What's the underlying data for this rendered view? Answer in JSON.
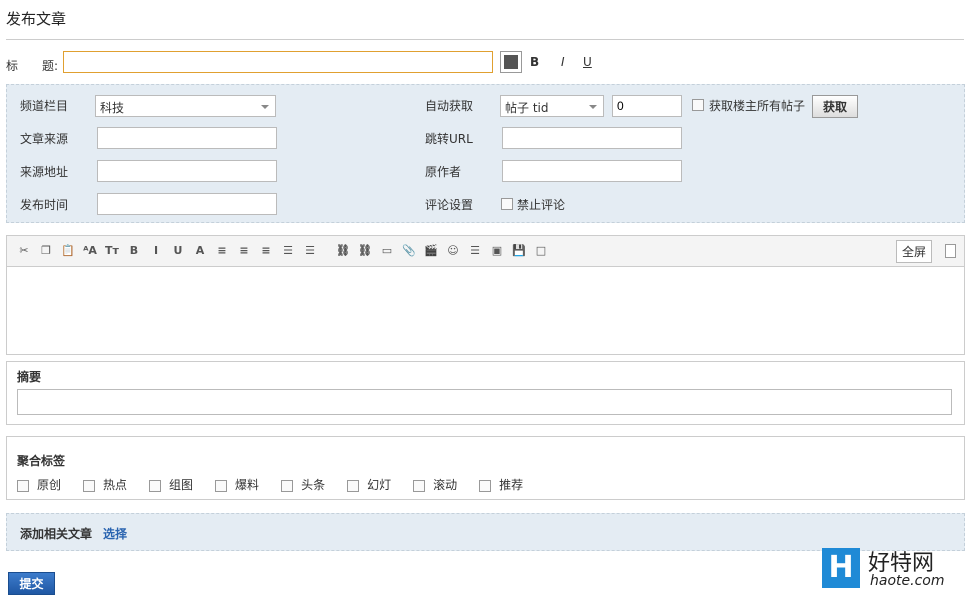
{
  "page_title": "发布文章",
  "title_row": {
    "label": "标　　题:",
    "value": "",
    "bold": "B",
    "italic": "I",
    "underline": "U"
  },
  "fields": {
    "channel": {
      "label": "频道栏目",
      "value": "科技"
    },
    "source": {
      "label": "文章来源",
      "value": ""
    },
    "source_url": {
      "label": "来源地址",
      "value": ""
    },
    "publish_time": {
      "label": "发布时间",
      "value": ""
    },
    "auto_fetch": {
      "label": "自动获取",
      "select": "帖子 tid",
      "value": "0",
      "checkbox_label": "获取楼主所有帖子",
      "button": "获取"
    },
    "redirect_url": {
      "label": "跳转URL",
      "value": ""
    },
    "author": {
      "label": "原作者",
      "value": ""
    },
    "comment": {
      "label": "评论设置",
      "checkbox_label": "禁止评论"
    }
  },
  "editor": {
    "fullscreen": "全屏",
    "toolbar_icons": [
      "cut-icon",
      "copy-icon",
      "paste-icon",
      "font-icon",
      "text-size-icon",
      "bold-icon",
      "italic-icon",
      "underline-icon",
      "font-color-icon",
      "align-left-icon",
      "align-center-icon",
      "align-right-icon",
      "ordered-list-icon",
      "indent-icon",
      "link-icon",
      "unlink-icon",
      "image-icon",
      "attachment-icon",
      "video-icon",
      "emoji-icon",
      "page-break-icon",
      "insert-image-icon",
      "save-icon",
      "checkbox-icon"
    ],
    "toolbar_glyphs": [
      "✂",
      "❐",
      "📋",
      "ᴬA",
      "Tт",
      "B",
      "I",
      "U",
      "A",
      "≡",
      "≡",
      "≡",
      "☰",
      "☰",
      "⛓",
      "⛓",
      "▭",
      "📎",
      "🎬",
      "☺",
      "☰",
      "▣",
      "💾",
      "□"
    ]
  },
  "summary": {
    "label": "摘要",
    "value": ""
  },
  "tags": {
    "label": "聚合标签",
    "items": [
      "原创",
      "热点",
      "组图",
      "爆料",
      "头条",
      "幻灯",
      "滚动",
      "推荐"
    ]
  },
  "related": {
    "label": "添加相关文章",
    "link": "选择"
  },
  "submit": "提交",
  "watermark": {
    "brand": "好特网",
    "domain": "haote.com"
  },
  "colors": {
    "panel": "#e4ecf3",
    "submit": "#2a64b0",
    "logo": "#1f8ad6"
  }
}
